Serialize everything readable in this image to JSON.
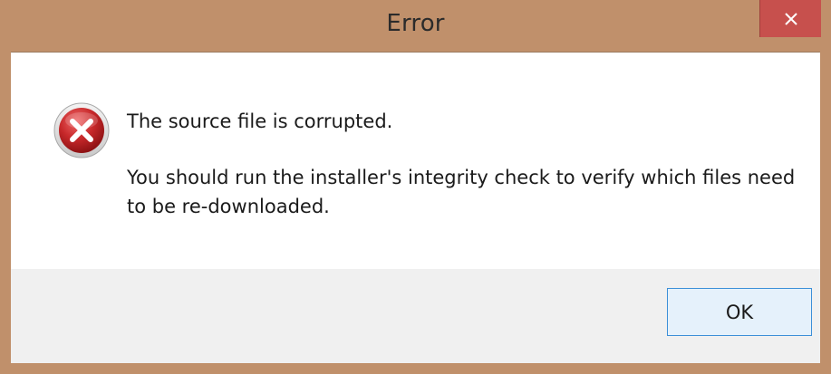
{
  "dialog": {
    "title": "Error",
    "close_icon": "close-icon",
    "icon": "error-icon",
    "message_line1": "The source file is corrupted.",
    "message_line2": "You should run the installer's integrity check to verify which files need to be re-downloaded.",
    "ok_label": "OK"
  },
  "colors": {
    "frame": "#c0906b",
    "close_button": "#c7504d",
    "content_bg": "#ffffff",
    "footer_bg": "#f0f0f0",
    "button_border": "#3c8fd8",
    "error_red": "#c0282a"
  }
}
